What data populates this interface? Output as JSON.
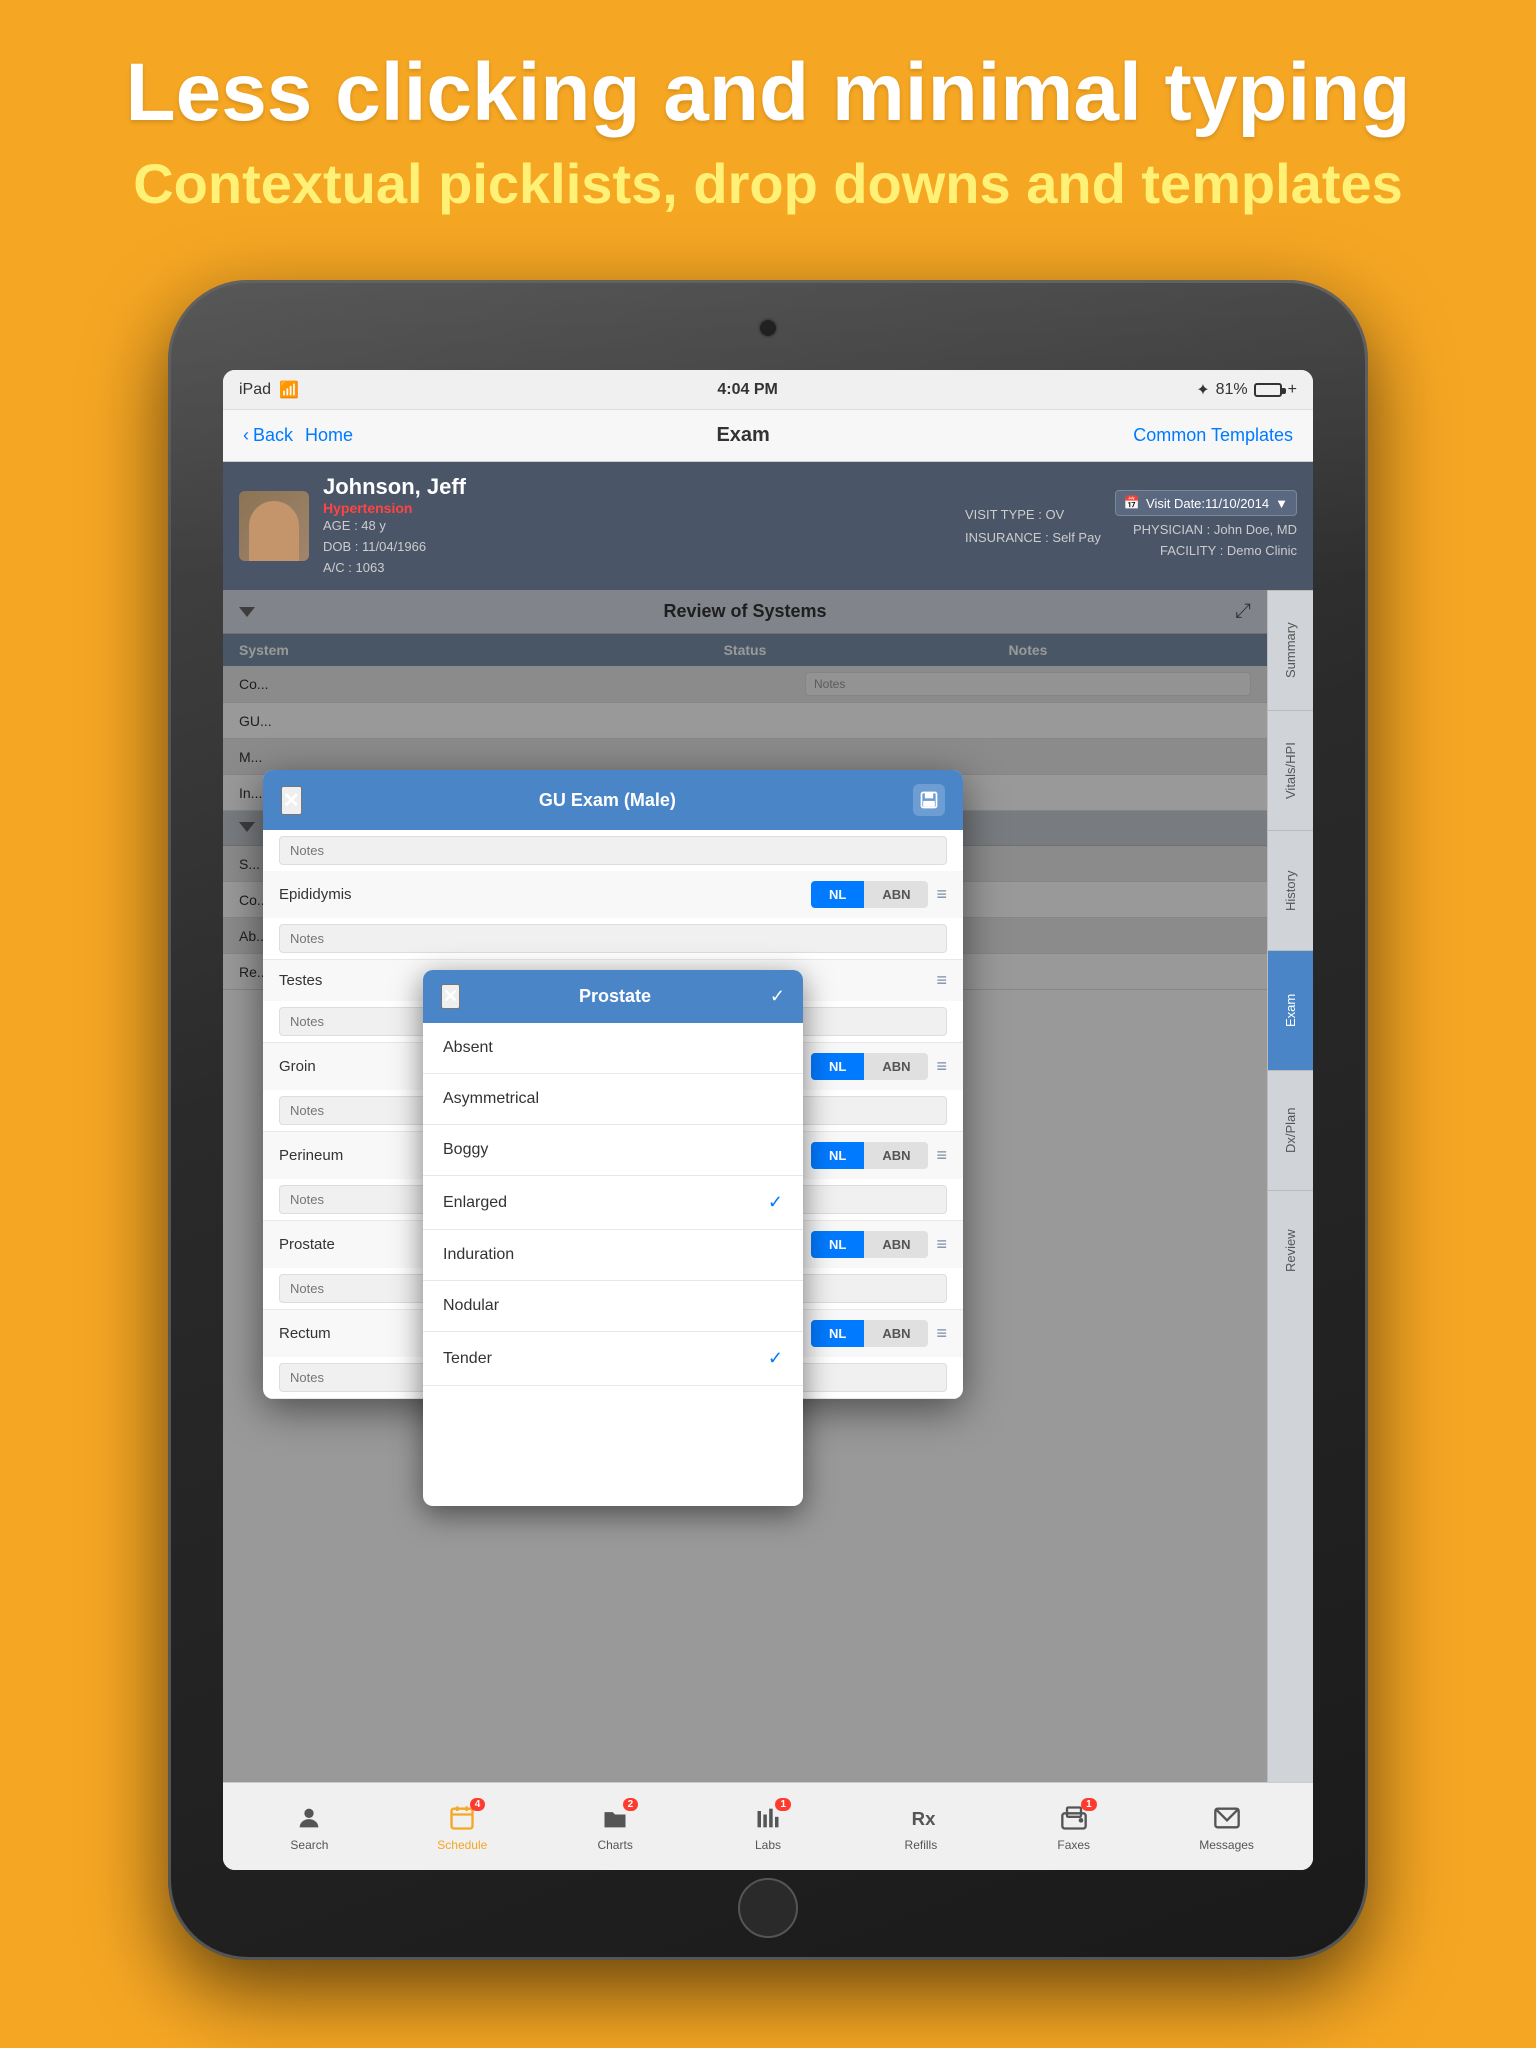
{
  "header": {
    "main_title": "Less clicking and minimal typing",
    "sub_title": "Contextual picklists, drop downs and templates"
  },
  "status_bar": {
    "device": "iPad",
    "wifi": "WiFi",
    "time": "4:04 PM",
    "bluetooth": "BT",
    "battery": "81%"
  },
  "nav": {
    "back": "Back",
    "home": "Home",
    "title": "Exam",
    "right": "Common Templates"
  },
  "patient": {
    "name": "Johnson, Jeff",
    "condition": "Hypertension",
    "age": "AGE : 48 y",
    "dob": "DOB : 11/04/1966",
    "ac": "A/C : 1063",
    "visit_type": "VISIT TYPE : OV",
    "insurance": "INSURANCE : Self Pay",
    "visit_date": "Visit Date:11/10/2014",
    "physician": "PHYSICIAN : John Doe, MD",
    "facility": "FACILITY : Demo Clinic"
  },
  "review_section": {
    "title": "Review of Systems",
    "columns": {
      "system": "System",
      "status": "Status",
      "notes": "Notes"
    }
  },
  "gu_exam": {
    "title": "GU Exam (Male)",
    "rows": [
      {
        "label": "Epididymis",
        "notes_placeholder": "Notes",
        "has_buttons": true
      },
      {
        "label": "Testes",
        "notes_placeholder": "Notes",
        "has_buttons": false
      },
      {
        "label": "Groin",
        "notes_placeholder": "Notes",
        "has_buttons": true
      },
      {
        "label": "Perineum",
        "notes_placeholder": "Notes",
        "has_buttons": true
      },
      {
        "label": "Prostate",
        "notes_placeholder": "Notes",
        "has_buttons": true
      },
      {
        "label": "Rectum",
        "notes_placeholder": "Notes",
        "has_buttons": true
      }
    ]
  },
  "prostate_dropdown": {
    "title": "Prostate",
    "items": [
      {
        "label": "Absent",
        "checked": false
      },
      {
        "label": "Asymmetrical",
        "checked": false
      },
      {
        "label": "Boggy",
        "checked": false
      },
      {
        "label": "Enlarged",
        "checked": true
      },
      {
        "label": "Induration",
        "checked": false
      },
      {
        "label": "Nodular",
        "checked": false
      },
      {
        "label": "Tender",
        "checked": true
      }
    ]
  },
  "sidebar_tabs": [
    {
      "label": "Summary",
      "active": false
    },
    {
      "label": "Vitals/HPI",
      "active": false
    },
    {
      "label": "History",
      "active": false
    },
    {
      "label": "Exam",
      "active": true
    },
    {
      "label": "Dx/Plan",
      "active": false
    },
    {
      "label": "Review",
      "active": false
    }
  ],
  "tab_bar": {
    "tabs": [
      {
        "label": "Search",
        "icon": "person",
        "badge": null
      },
      {
        "label": "Schedule",
        "icon": "calendar",
        "badge": "4",
        "active": true
      },
      {
        "label": "Charts",
        "icon": "folder",
        "badge": "2"
      },
      {
        "label": "Labs",
        "icon": "bars",
        "badge": "1"
      },
      {
        "label": "Refills",
        "icon": "rx",
        "badge": null
      },
      {
        "label": "Faxes",
        "icon": "fax",
        "badge": "1"
      },
      {
        "label": "Messages",
        "icon": "envelope",
        "badge": null
      }
    ]
  }
}
